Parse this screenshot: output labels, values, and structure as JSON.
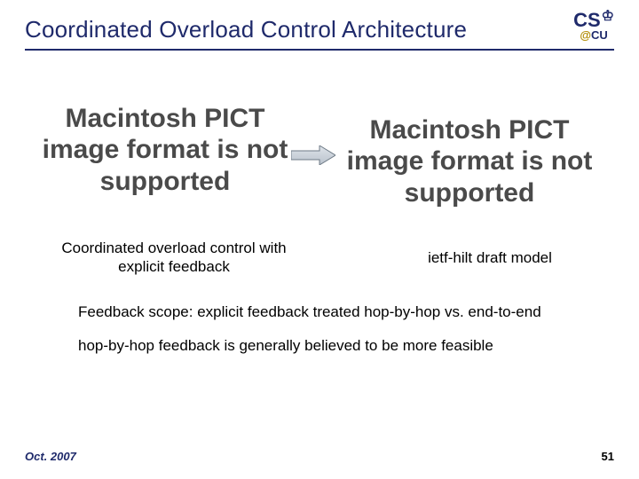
{
  "header": {
    "title": "Coordinated Overload Control Architecture",
    "logo_top": "CS",
    "logo_at": "@",
    "logo_bottom": "CU"
  },
  "placeholders": {
    "pict_text": "Macintosh PICT image format is not supported"
  },
  "captions": {
    "left": "Coordinated overload control with explicit feedback",
    "right": "ietf-hilt draft model"
  },
  "body": {
    "line1": "Feedback scope: explicit feedback treated hop-by-hop vs. end-to-end",
    "line2": "hop-by-hop feedback is generally believed to be more feasible"
  },
  "footer": {
    "date": "Oct. 2007",
    "page": "51"
  }
}
